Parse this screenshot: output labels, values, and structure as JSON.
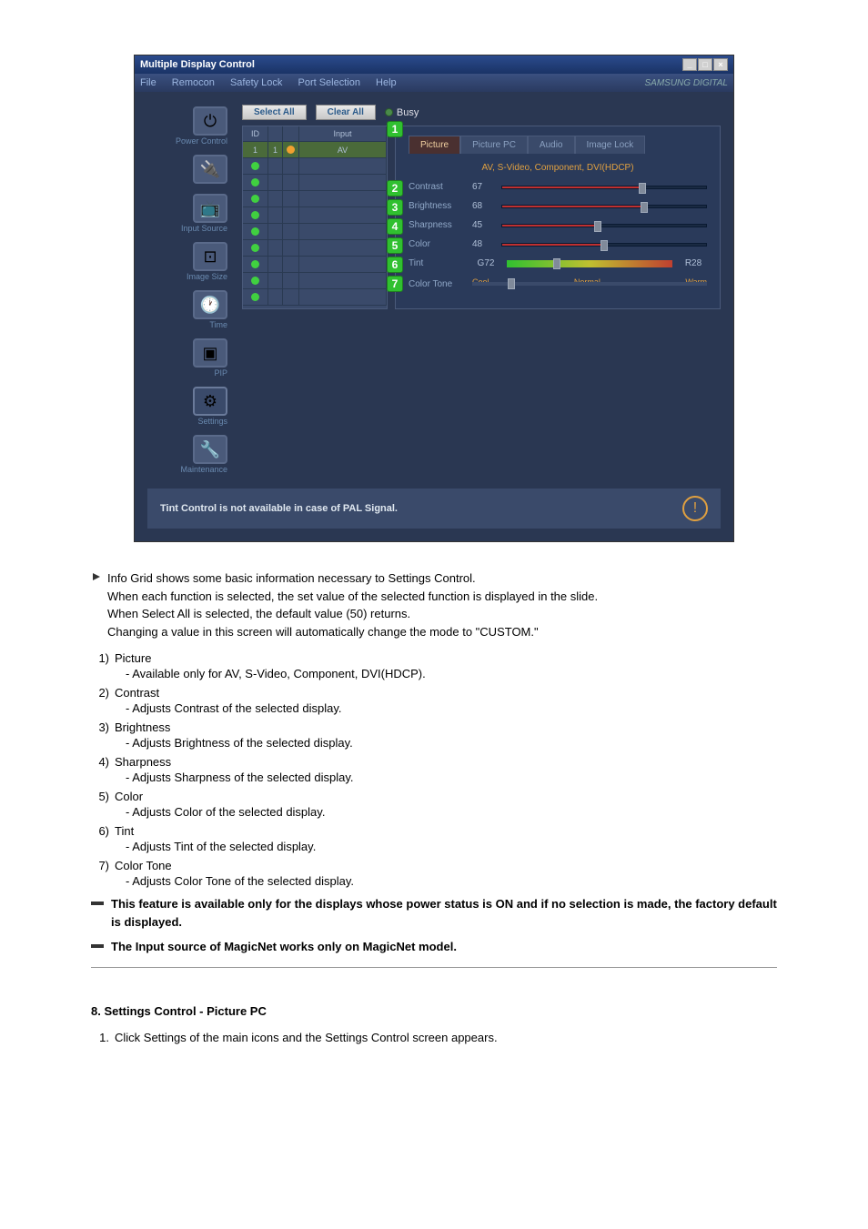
{
  "window": {
    "title": "Multiple Display Control",
    "menu": [
      "File",
      "Remocon",
      "Safety Lock",
      "Port Selection",
      "Help"
    ],
    "brand": "SAMSUNG DIGITAL"
  },
  "sidebar": {
    "items": [
      {
        "label": "Power Control"
      },
      {
        "label": ""
      },
      {
        "label": "Input Source"
      },
      {
        "label": "Image Size"
      },
      {
        "label": "Time"
      },
      {
        "label": "PIP"
      },
      {
        "label": "Settings"
      },
      {
        "label": "Maintenance"
      }
    ]
  },
  "toolbar": {
    "select_all": "Select All",
    "clear_all": "Clear All",
    "busy": "Busy"
  },
  "grid": {
    "headers": {
      "id": "ID",
      "input": "Input"
    },
    "rows": [
      {
        "id": "1",
        "c": "1",
        "input": "AV"
      },
      {
        "id": "",
        "c": "",
        "input": ""
      },
      {
        "id": "",
        "c": "",
        "input": ""
      },
      {
        "id": "",
        "c": "",
        "input": ""
      },
      {
        "id": "",
        "c": "",
        "input": ""
      },
      {
        "id": "",
        "c": "",
        "input": ""
      },
      {
        "id": "",
        "c": "",
        "input": ""
      },
      {
        "id": "",
        "c": "",
        "input": ""
      },
      {
        "id": "",
        "c": "",
        "input": ""
      },
      {
        "id": "",
        "c": "",
        "input": ""
      }
    ]
  },
  "settings": {
    "tabs": [
      "Picture",
      "Picture PC",
      "Audio",
      "Image Lock"
    ],
    "mode_label": "AV, S-Video, Component, DVI(HDCP)",
    "sliders": {
      "contrast": {
        "label": "Contrast",
        "value": "67"
      },
      "brightness": {
        "label": "Brightness",
        "value": "68"
      },
      "sharpness": {
        "label": "Sharpness",
        "value": "45"
      },
      "color": {
        "label": "Color",
        "value": "48"
      },
      "tint": {
        "label": "Tint",
        "left": "G72",
        "right": "R28"
      },
      "color_tone": {
        "label": "Color Tone",
        "options": [
          "Cool",
          "Normal",
          "Warm"
        ]
      }
    }
  },
  "status": "Tint Control is not available in case of PAL Signal.",
  "doc": {
    "info_lines": [
      "Info Grid shows some basic information necessary to Settings Control.",
      "When each function is selected, the set value of the selected function is displayed in the slide.",
      "When Select All is selected, the default value (50) returns.",
      "Changing a value in this screen will automatically change the mode to \"CUSTOM.\""
    ],
    "items": [
      {
        "n": "1)",
        "title": "Picture",
        "desc": "- Available only for AV, S-Video, Component, DVI(HDCP)."
      },
      {
        "n": "2)",
        "title": "Contrast",
        "desc": "- Adjusts Contrast of the selected display."
      },
      {
        "n": "3)",
        "title": "Brightness",
        "desc": "- Adjusts Brightness of the selected display."
      },
      {
        "n": "4)",
        "title": "Sharpness",
        "desc": "- Adjusts Sharpness of the selected display."
      },
      {
        "n": "5)",
        "title": "Color",
        "desc": "- Adjusts Color of the selected display."
      },
      {
        "n": "6)",
        "title": "Tint",
        "desc": "- Adjusts Tint of the selected display."
      },
      {
        "n": "7)",
        "title": "Color Tone",
        "desc": "- Adjusts Color Tone of the selected display."
      }
    ],
    "notes": [
      "This feature is available only for the displays whose power status is ON and if no selection is made, the factory default is displayed.",
      "The Input source of MagicNet works only on MagicNet model."
    ],
    "section_title": "8. Settings Control - Picture PC",
    "step": {
      "n": "1.",
      "text": "Click Settings of the main icons and the Settings Control screen appears."
    }
  }
}
